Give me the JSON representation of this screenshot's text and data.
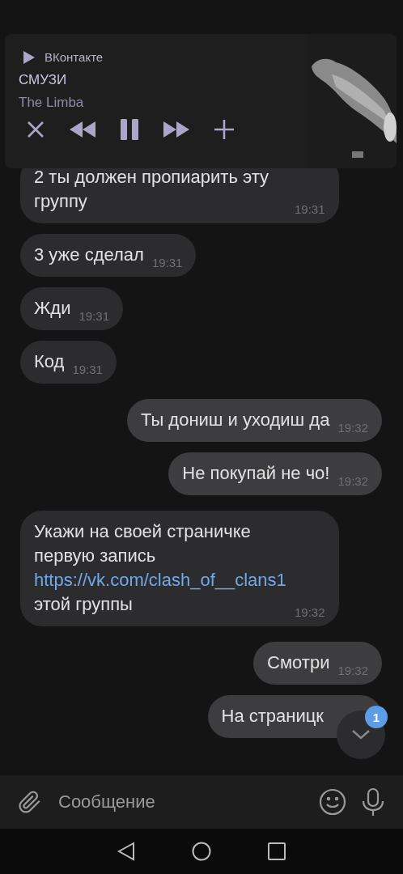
{
  "player": {
    "source": "ВКонтакте",
    "title": "СМУЗИ",
    "artist": "The Limba",
    "playing": true
  },
  "messages": [
    {
      "outgoing": false,
      "parts": [
        {
          "kind": "text",
          "text": "2 ты должен пропиарить эту группу"
        }
      ],
      "time": "19:31"
    },
    {
      "outgoing": false,
      "parts": [
        {
          "kind": "text",
          "text": "3 уже сделал"
        }
      ],
      "time": "19:31"
    },
    {
      "outgoing": false,
      "parts": [
        {
          "kind": "text",
          "text": "Жди"
        }
      ],
      "time": "19:31"
    },
    {
      "outgoing": false,
      "parts": [
        {
          "kind": "text",
          "text": "Код"
        }
      ],
      "time": "19:31"
    },
    {
      "outgoing": true,
      "parts": [
        {
          "kind": "text",
          "text": "Ты дониш и уходиш да"
        }
      ],
      "time": "19:32"
    },
    {
      "outgoing": true,
      "parts": [
        {
          "kind": "text",
          "text": "Не покупай не чо!"
        }
      ],
      "time": "19:32"
    },
    {
      "outgoing": false,
      "parts": [
        {
          "kind": "text",
          "text": "Укажи на своей страничке первую запись "
        },
        {
          "kind": "link",
          "text": "https://vk.com/clash_of__clans1"
        },
        {
          "kind": "text",
          "text": " этой группы"
        }
      ],
      "time": "19:32"
    },
    {
      "outgoing": true,
      "parts": [
        {
          "kind": "text",
          "text": "Смотри"
        }
      ],
      "time": "19:32"
    },
    {
      "outgoing": true,
      "parts": [
        {
          "kind": "text",
          "text": "На страницк"
        }
      ]
    }
  ],
  "scroll_button": {
    "badge": "1"
  },
  "composer": {
    "placeholder": "Сообщение"
  }
}
